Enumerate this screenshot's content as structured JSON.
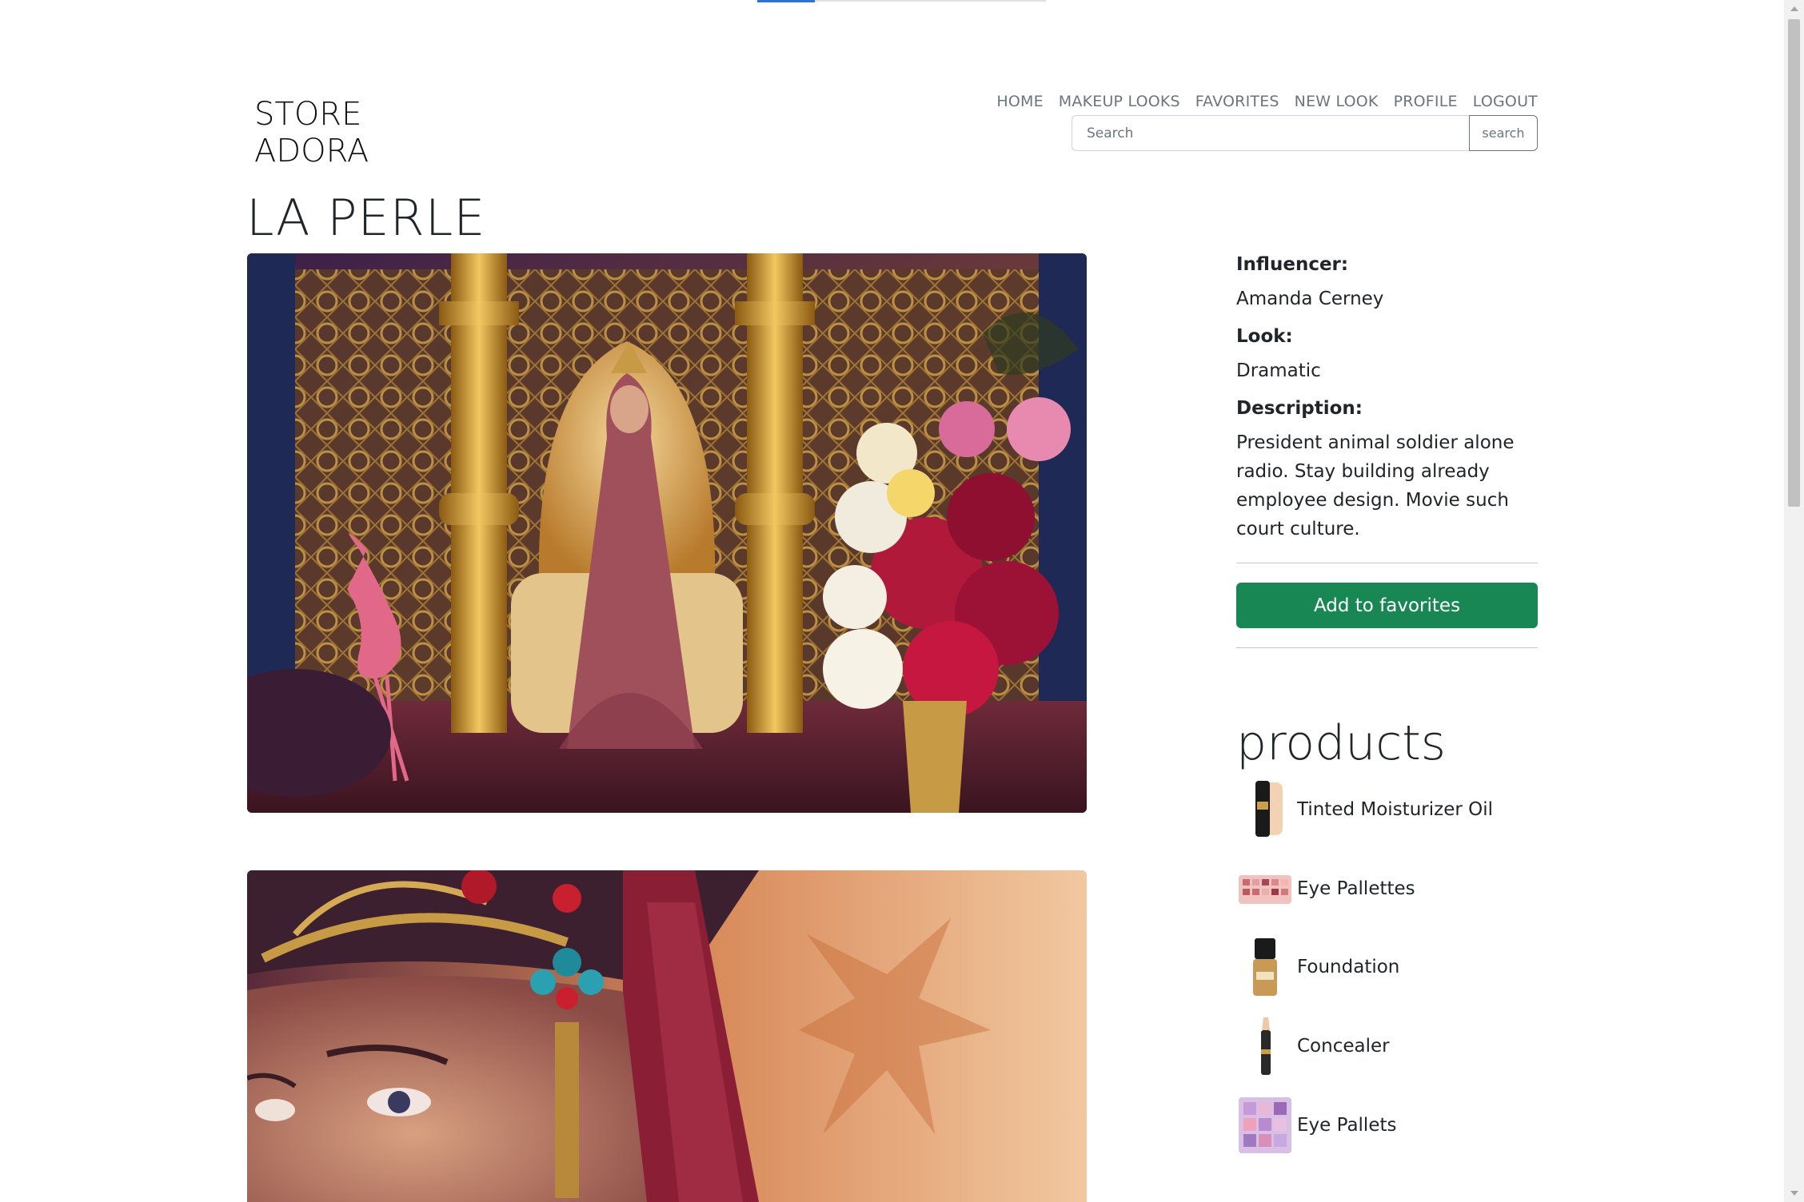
{
  "brand": {
    "line1": "STORE",
    "line2": "ADORA"
  },
  "nav": {
    "items": [
      "HOME",
      "MAKEUP LOOKS",
      "FAVORITES",
      "NEW LOOK",
      "PROFILE",
      "LOGOUT"
    ]
  },
  "search": {
    "placeholder": "Search",
    "button_label": "search"
  },
  "look": {
    "title": "LA PERLE",
    "influencer_label": "Influencer:",
    "influencer": "Amanda Cerney",
    "look_label": "Look:",
    "look_type": "Dramatic",
    "description_label": "Description:",
    "description": "President animal soldier alone radio. Stay building already employee design. Movie such court culture.",
    "favorite_button": "Add to favorites"
  },
  "products": {
    "title": "products",
    "items": [
      {
        "name": "Tinted Moisturizer Oil",
        "icon": "tube-icon"
      },
      {
        "name": "Eye Pallettes",
        "icon": "palette-icon"
      },
      {
        "name": "Foundation",
        "icon": "bottle-icon"
      },
      {
        "name": "Concealer",
        "icon": "wand-icon"
      },
      {
        "name": "Eye Pallets",
        "icon": "palette-icon"
      }
    ]
  },
  "colors": {
    "accent": "#198754",
    "nav_text": "#6c757d",
    "progress": "#2b73d9"
  }
}
